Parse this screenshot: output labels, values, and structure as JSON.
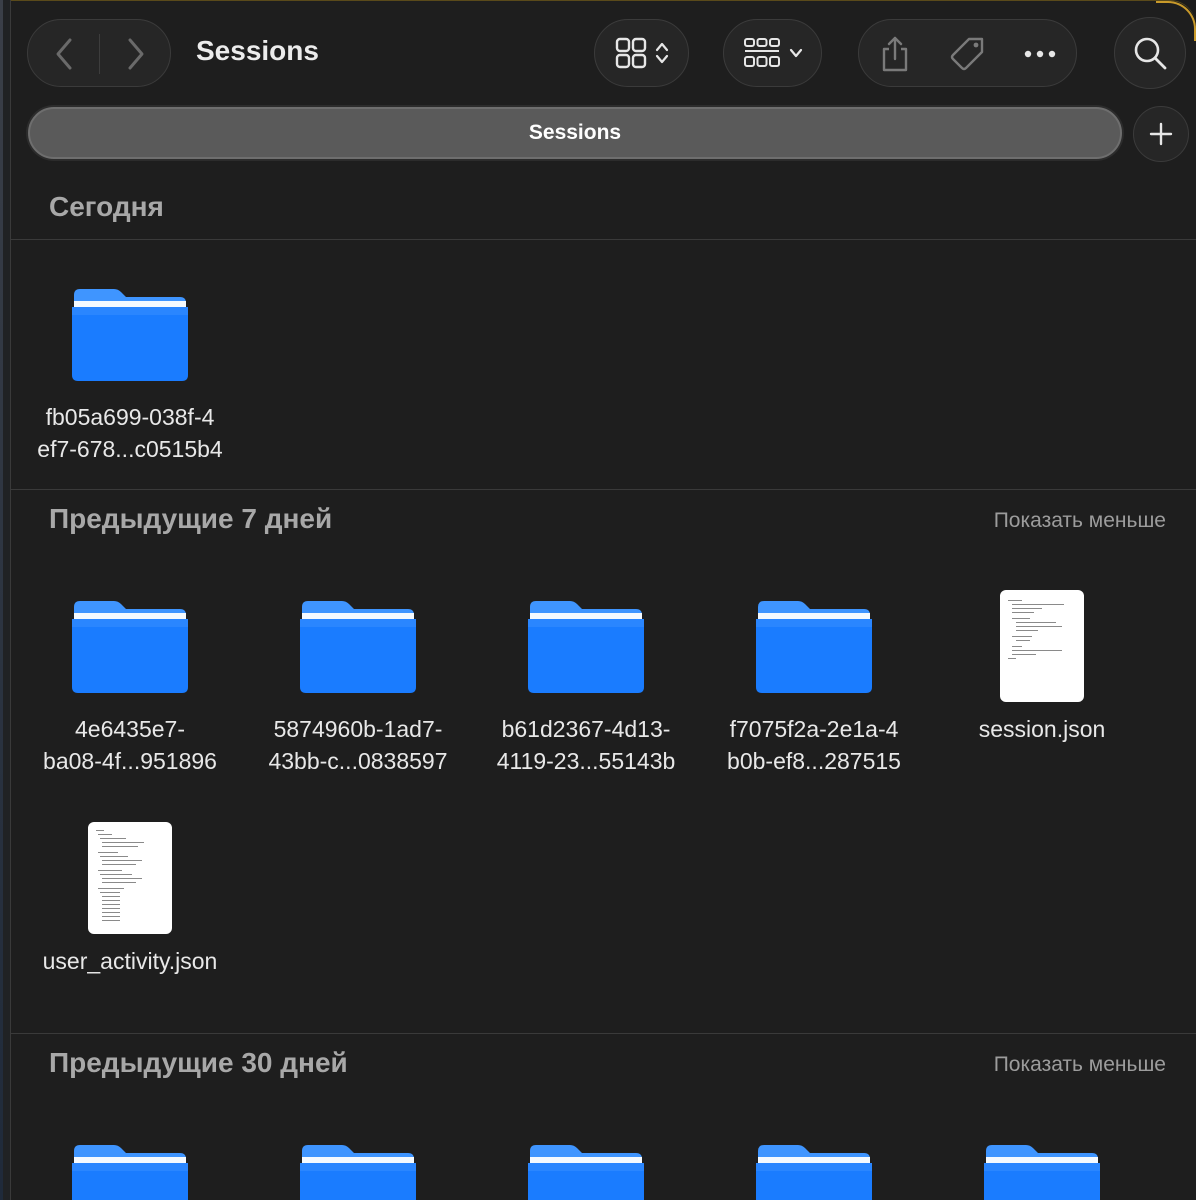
{
  "window": {
    "title": "Sessions",
    "tab_label": "Sessions"
  },
  "toolbar": {
    "back_icon": "chevron-left-icon",
    "forward_icon": "chevron-right-icon",
    "view_icon": "grid-view-icon",
    "group_icon": "group-by-icon",
    "share_icon": "share-icon",
    "tag_icon": "tag-icon",
    "more_icon": "ellipsis-icon",
    "search_icon": "search-icon",
    "new_tab_icon": "plus-icon"
  },
  "colors": {
    "folder": "#1a7cff",
    "folder_top": "#3f95ff",
    "background": "#1e1e1e",
    "section_text": "#a8a8a8"
  },
  "sections": [
    {
      "title": "Сегодня",
      "action": "",
      "items": [
        {
          "type": "folder",
          "line1": "fb05a699-038f-4",
          "line2": "ef7-678...c0515b4"
        }
      ]
    },
    {
      "title": "Предыдущие 7 дней",
      "action": "Показать меньше",
      "items": [
        {
          "type": "folder",
          "line1": "4e6435e7-",
          "line2": "ba08-4f...951896"
        },
        {
          "type": "folder",
          "line1": "5874960b-1ad7-",
          "line2": "43bb-c...0838597"
        },
        {
          "type": "folder",
          "line1": "b61d2367-4d13-",
          "line2": "4119-23...55143b"
        },
        {
          "type": "folder",
          "line1": "f7075f2a-2e1a-4",
          "line2": "b0b-ef8...287515"
        },
        {
          "type": "json",
          "line1": "session.json",
          "line2": ""
        },
        {
          "type": "json",
          "line1": "user_activity.json",
          "line2": ""
        }
      ]
    },
    {
      "title": "Предыдущие 30 дней",
      "action": "Показать меньше",
      "items": [
        {
          "type": "folder",
          "line1": "",
          "line2": ""
        },
        {
          "type": "folder",
          "line1": "",
          "line2": ""
        },
        {
          "type": "folder",
          "line1": "",
          "line2": ""
        },
        {
          "type": "folder",
          "line1": "",
          "line2": ""
        },
        {
          "type": "folder",
          "line1": "",
          "line2": ""
        }
      ]
    }
  ]
}
